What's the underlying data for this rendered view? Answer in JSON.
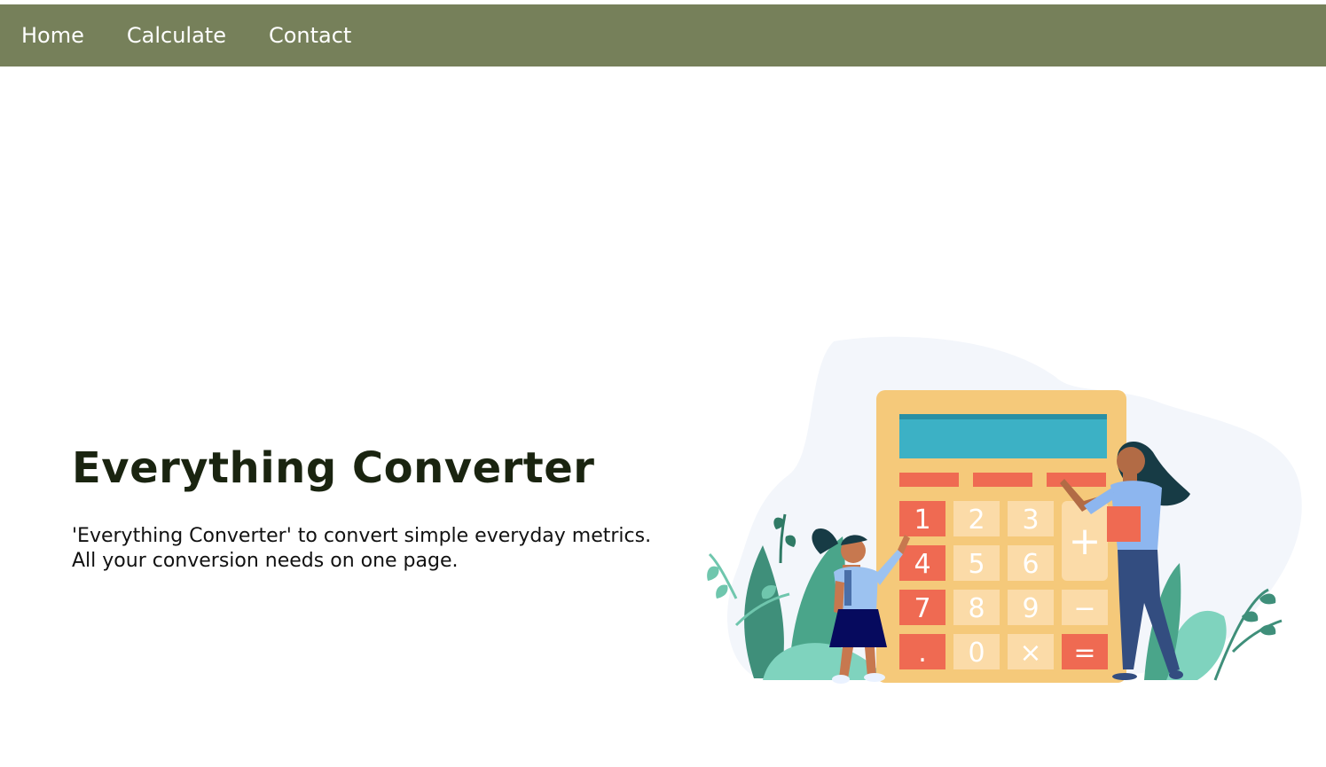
{
  "nav": {
    "items": [
      {
        "label": "Home"
      },
      {
        "label": "Calculate"
      },
      {
        "label": "Contact"
      }
    ],
    "background_color": "#76805a"
  },
  "hero": {
    "title": "Everything Converter",
    "description_line1": "'Everything Converter' to convert simple everyday metrics.",
    "description_line2": "All your conversion needs on one page."
  },
  "illustration": {
    "icon": "calculator-illustration",
    "keys": [
      "1",
      "2",
      "3",
      "+",
      "4",
      "5",
      "6",
      "7",
      "8",
      "9",
      "−",
      ".",
      "0",
      "×",
      "="
    ]
  }
}
